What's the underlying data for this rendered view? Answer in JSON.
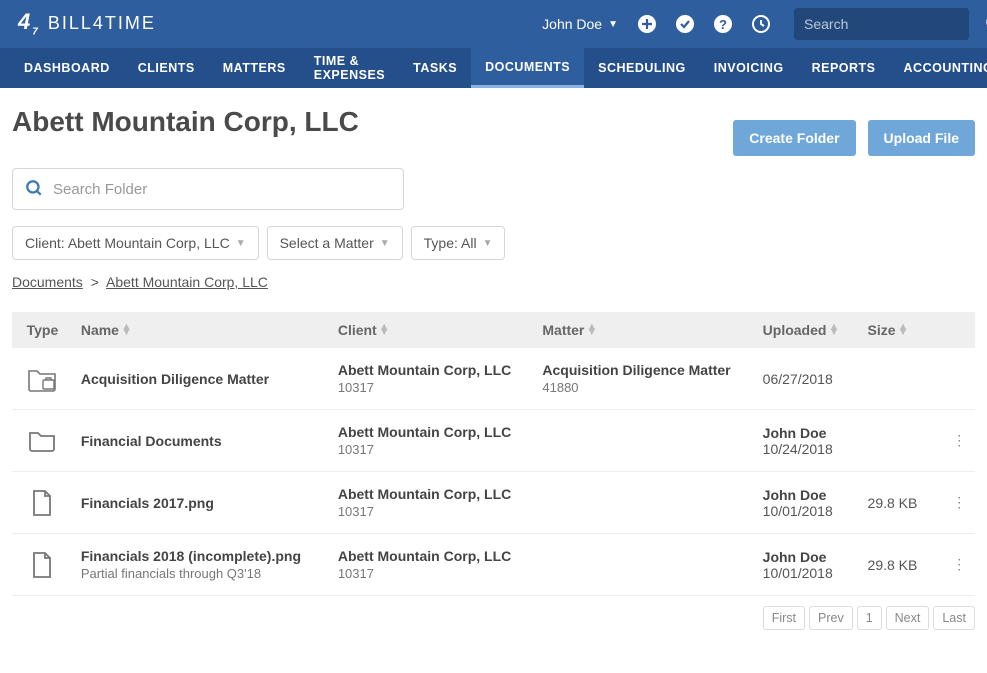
{
  "app_name": "BILL4TIME",
  "user_name": "John Doe",
  "search_placeholder": "Search",
  "nav": [
    {
      "label": "DASHBOARD",
      "active": false
    },
    {
      "label": "CLIENTS",
      "active": false
    },
    {
      "label": "MATTERS",
      "active": false
    },
    {
      "label": "TIME & EXPENSES",
      "active": false
    },
    {
      "label": "TASKS",
      "active": false
    },
    {
      "label": "DOCUMENTS",
      "active": true
    },
    {
      "label": "SCHEDULING",
      "active": false
    },
    {
      "label": "INVOICING",
      "active": false
    },
    {
      "label": "REPORTS",
      "active": false
    },
    {
      "label": "ACCOUNTING",
      "active": false
    }
  ],
  "page_title": "Abett Mountain Corp, LLC",
  "actions": {
    "create_folder": "Create Folder",
    "upload_file": "Upload File"
  },
  "folder_search_placeholder": "Search Folder",
  "filters": {
    "client_prefix": "Client: ",
    "client_value": "Abett Mountain Corp, LLC",
    "matter_label": "Select a Matter",
    "type_prefix": "Type: ",
    "type_value": "All"
  },
  "breadcrumb": {
    "root": "Documents",
    "current": "Abett Mountain Corp, LLC"
  },
  "columns": {
    "type": "Type",
    "name": "Name",
    "client": "Client",
    "matter": "Matter",
    "uploaded": "Uploaded",
    "size": "Size"
  },
  "rows": [
    {
      "type": "matter-folder",
      "name": "Acquisition Diligence Matter",
      "name_sub": "",
      "client": "Abett Mountain Corp, LLC",
      "client_sub": "10317",
      "matter": "Acquisition Diligence Matter",
      "matter_sub": "41880",
      "uploaded_by": "",
      "uploaded_date": "06/27/2018",
      "size": "",
      "menu": false
    },
    {
      "type": "folder",
      "name": "Financial Documents",
      "name_sub": "",
      "client": "Abett Mountain Corp, LLC",
      "client_sub": "10317",
      "matter": "",
      "matter_sub": "",
      "uploaded_by": "John Doe",
      "uploaded_date": "10/24/2018",
      "size": "",
      "menu": true
    },
    {
      "type": "file",
      "name": "Financials 2017.png",
      "name_sub": "",
      "client": "Abett Mountain Corp, LLC",
      "client_sub": "10317",
      "matter": "",
      "matter_sub": "",
      "uploaded_by": "John Doe",
      "uploaded_date": "10/01/2018",
      "size": "29.8 KB",
      "menu": true
    },
    {
      "type": "file",
      "name": "Financials 2018 (incomplete).png",
      "name_sub": "Partial financials through Q3'18",
      "client": "Abett Mountain Corp, LLC",
      "client_sub": "10317",
      "matter": "",
      "matter_sub": "",
      "uploaded_by": "John Doe",
      "uploaded_date": "10/01/2018",
      "size": "29.8 KB",
      "menu": true
    }
  ],
  "pagination": {
    "first": "First",
    "prev": "Prev",
    "page": "1",
    "next": "Next",
    "last": "Last"
  }
}
